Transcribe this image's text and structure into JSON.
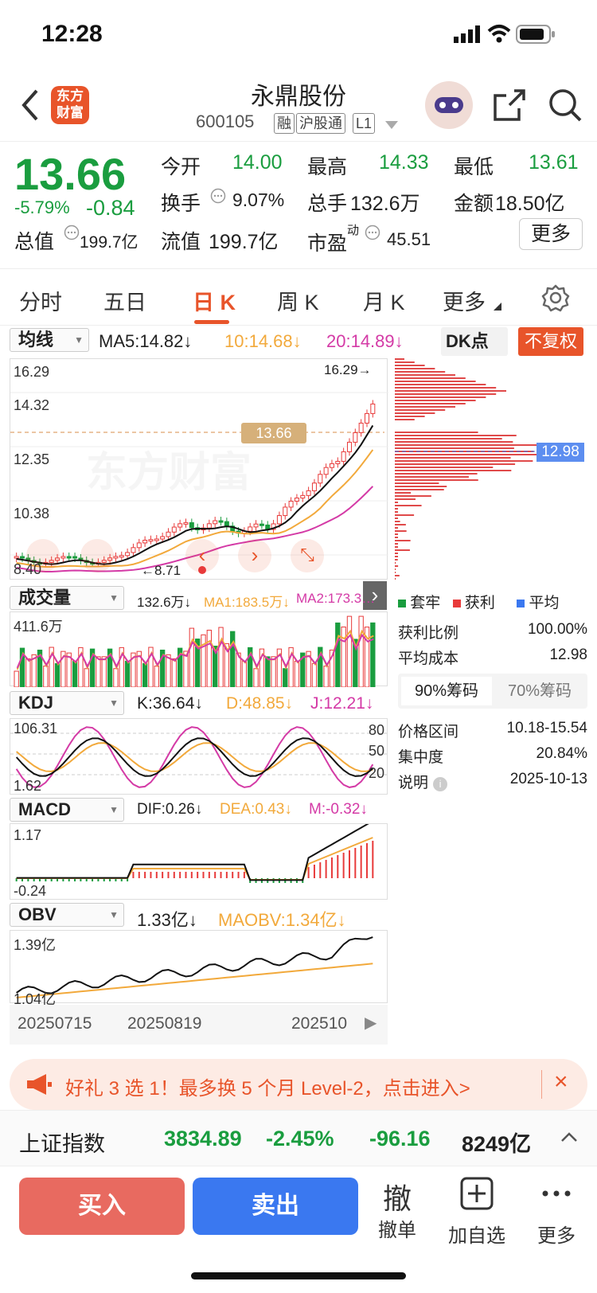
{
  "status": {
    "time": "12:28"
  },
  "header": {
    "logo_text": "东方财富",
    "stock_name": "永鼎股份",
    "stock_code": "600105",
    "tags": [
      "融",
      "沪股通",
      "L1"
    ]
  },
  "quote": {
    "price": "13.66",
    "pct": "-5.79%",
    "change": "-0.84",
    "open_label": "今开",
    "open": "14.00",
    "high_label": "最高",
    "high": "14.33",
    "low_label": "最低",
    "low": "13.61",
    "turnover_label": "换手",
    "turnover": "9.07%",
    "volume_label": "总手",
    "volume": "132.6万",
    "amount_label": "金额",
    "amount": "18.50亿",
    "mktcap_label": "总值",
    "mktcap": "199.7亿",
    "float_label": "流值",
    "float": "199.7亿",
    "pe_label": "市盈",
    "pe_sup": "动",
    "pe": "45.51",
    "more": "更多"
  },
  "tabs": [
    "分时",
    "五日",
    "日 K",
    "周 K",
    "月 K",
    "更多"
  ],
  "kline": {
    "ma_select": "均线",
    "ma5": "MA5:14.82↓",
    "ma10": "10:14.68↓",
    "ma20": "20:14.89↓",
    "dk_label": "DK点",
    "fq_label": "不复权",
    "y_labels": [
      "16.29",
      "14.32",
      "12.35",
      "10.38",
      "8.40"
    ],
    "high_mark": "16.29→",
    "low_mark": "←8.71",
    "price_tag": "13.66",
    "avg_cost_tag": "12.98",
    "watermark": "东方财富"
  },
  "volume": {
    "select": "成交量",
    "v": "132.6万↓",
    "ma1": "MA1:183.5万↓",
    "ma2": "MA2:173.3…",
    "y_top": "411.6万"
  },
  "kdj": {
    "select": "KDJ",
    "k": "K:36.64↓",
    "d": "D:48.85↓",
    "j": "J:12.21↓",
    "y_top": "106.31",
    "y_bottom": "1.62",
    "levels": [
      "80",
      "50",
      "20"
    ]
  },
  "macd": {
    "select": "MACD",
    "dif": "DIF:0.26↓",
    "dea": "DEA:0.43↓",
    "m": "M:-0.32↓",
    "y_top": "1.17",
    "y_bottom": "-0.24"
  },
  "obv": {
    "select": "OBV",
    "v": "1.33亿↓",
    "ma": "MAOBV:1.34亿↓",
    "y_top": "1.39亿",
    "y_bottom": "1.04亿"
  },
  "dates": [
    "20250715",
    "20250819",
    "202510"
  ],
  "chips": {
    "legend": [
      "套牢",
      "获利",
      "平均"
    ],
    "profit_ratio_label": "获利比例",
    "profit_ratio": "100.00%",
    "avg_cost_label": "平均成本",
    "avg_cost": "12.98",
    "tab90": "90%筹码",
    "tab70": "70%筹码",
    "range_label": "价格区间",
    "range": "10.18-15.54",
    "concentration_label": "集中度",
    "concentration": "20.84%",
    "note_label": "说明",
    "note_date": "2025-10-13"
  },
  "banner": {
    "text": "好礼 3 选 1！最多换 5 个月 Level-2，点击进入>"
  },
  "index": {
    "name": "上证指数",
    "value": "3834.89",
    "pct": "-2.45%",
    "change": "-96.16",
    "amount": "8249亿"
  },
  "actions": {
    "buy": "买入",
    "sell": "卖出",
    "cancel_glyph": "撤",
    "cancel": "撤单",
    "add": "加自选",
    "more": "更多"
  },
  "colors": {
    "up": "#e83a3a",
    "down": "#1a9d3f",
    "accent": "#e8542a",
    "ma10": "#f2a93b",
    "ma20": "#d43aa6",
    "sell_btn": "#3a78f0"
  }
}
